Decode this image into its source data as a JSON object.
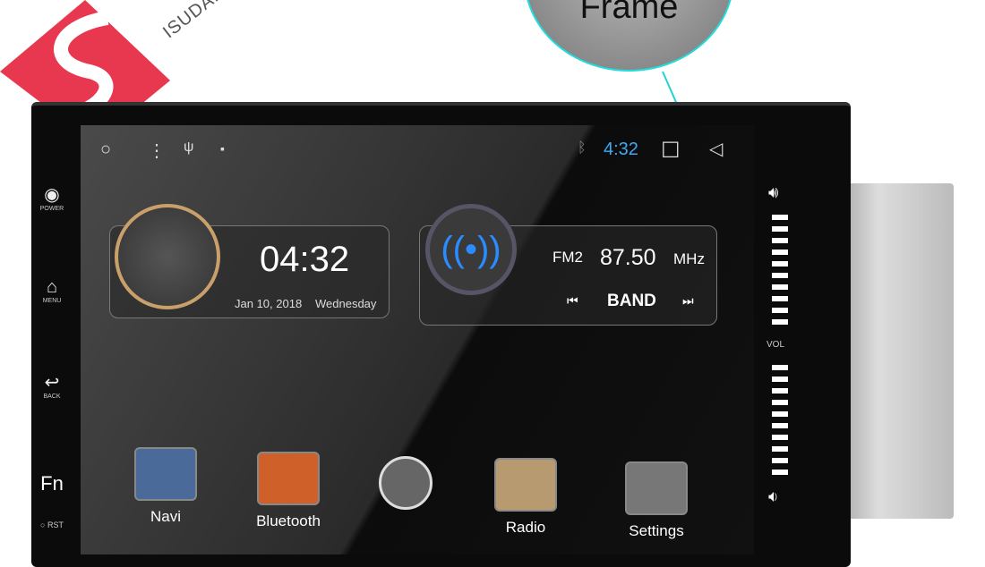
{
  "brand": {
    "subtitle": "ISUDAR",
    "color": "#e8384f"
  },
  "callout": {
    "label": "Frame",
    "accent": "#22d3d3"
  },
  "side_buttons": [
    {
      "label": "POWER",
      "icon": "power-icon"
    },
    {
      "label": "MENU",
      "icon": "home-icon"
    },
    {
      "label": "BACK",
      "icon": "back-icon"
    },
    {
      "label": "Fn"
    },
    {
      "label": "RST"
    }
  ],
  "status_bar": {
    "time": "4:32",
    "time_color": "#3fa9f5",
    "icons": [
      "circle-icon",
      "more-icon",
      "usb-icon",
      "image-icon",
      "bluetooth-icon",
      "square-icon",
      "back-triangle-icon"
    ]
  },
  "clock_widget": {
    "time": "04:32",
    "date": "Jan 10, 2018",
    "weekday": "Wednesday"
  },
  "radio_widget": {
    "band": "FM2",
    "frequency": "87.50",
    "unit": "MHz",
    "band_button": "BAND"
  },
  "volume": {
    "label": "VOL"
  },
  "apps": [
    {
      "label": "Navi"
    },
    {
      "label": "Bluetooth"
    },
    {
      "label": ""
    },
    {
      "label": "Radio"
    },
    {
      "label": "Settings"
    }
  ]
}
